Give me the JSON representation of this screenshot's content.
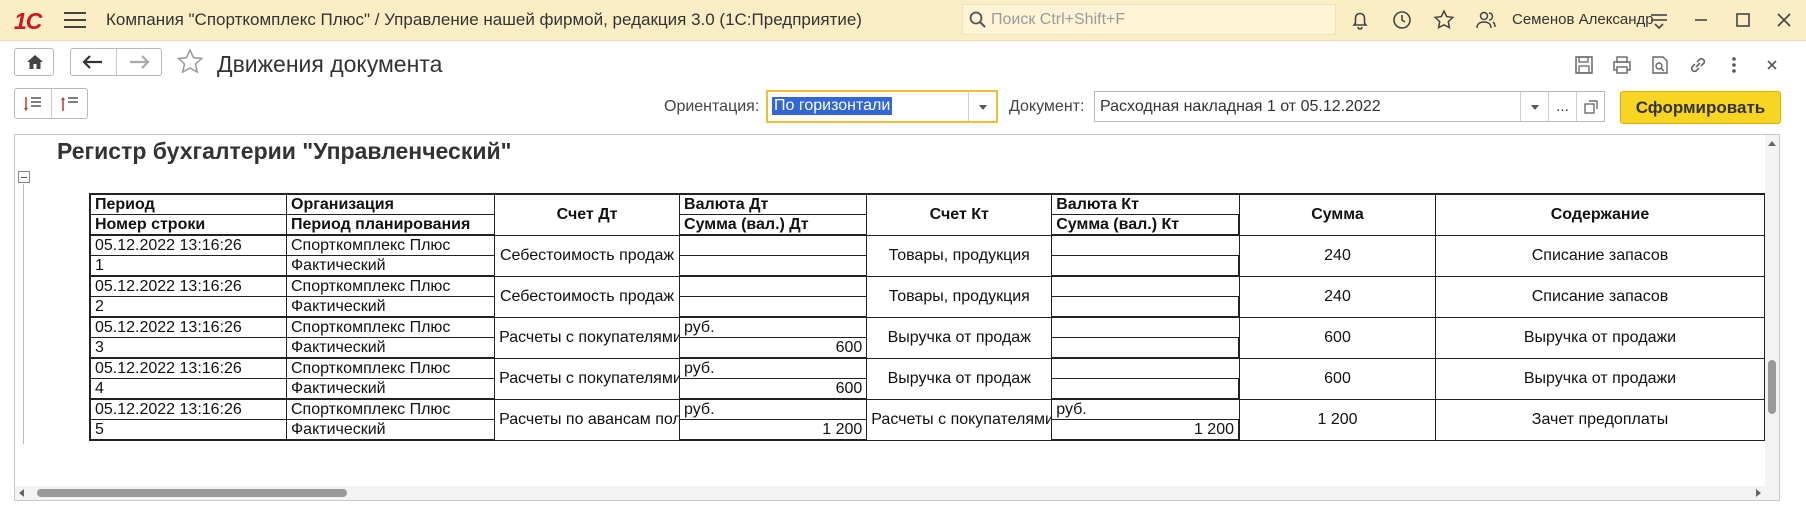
{
  "window": {
    "logo": "1С",
    "app_title": "Компания \"Спорткомплекс Плюс\" / Управление нашей фирмой, редакция 3.0  (1С:Предприятие)",
    "search_placeholder": "Поиск Ctrl+Shift+F",
    "user_name": "Семенов Александр"
  },
  "toolbar": {
    "doc_title": "Движения документа"
  },
  "form": {
    "orientation_label": "Ориентация:",
    "orientation_value": "По горизонтали",
    "document_label": "Документ:",
    "document_value": "Расходная накладная 1 от 05.12.2022",
    "ellipsis": "...",
    "generate_button": "Сформировать"
  },
  "report": {
    "title": "Регистр бухгалтерии \"Управленческий\"",
    "headers": {
      "period": "Период",
      "line_no": "Номер строки",
      "organization": "Организация",
      "plan_period": "Период планирования",
      "account_dt": "Счет Дт",
      "currency_dt": "Валюта Дт",
      "amount_cur_dt": "Сумма (вал.) Дт",
      "account_kt": "Счет Кт",
      "currency_kt": "Валюта Кт",
      "amount_cur_kt": "Сумма (вал.) Кт",
      "amount": "Сумма",
      "content": "Содержание"
    },
    "rows": [
      {
        "period": "05.12.2022 13:16:26",
        "line_no": "1",
        "organization": "Спорткомплекс Плюс",
        "plan_period": "Фактический",
        "account_dt": "Себестоимость продаж",
        "currency_dt": "",
        "amount_cur_dt": "",
        "account_kt": "Товары, продукция",
        "currency_kt": "",
        "amount_cur_kt": "",
        "amount": "240",
        "content": "Списание запасов"
      },
      {
        "period": "05.12.2022 13:16:26",
        "line_no": "2",
        "organization": "Спорткомплекс Плюс",
        "plan_period": "Фактический",
        "account_dt": "Себестоимость продаж",
        "currency_dt": "",
        "amount_cur_dt": "",
        "account_kt": "Товары, продукция",
        "currency_kt": "",
        "amount_cur_kt": "",
        "amount": "240",
        "content": "Списание запасов"
      },
      {
        "period": "05.12.2022 13:16:26",
        "line_no": "3",
        "organization": "Спорткомплекс Плюс",
        "plan_period": "Фактический",
        "account_dt": "Расчеты с покупателями",
        "currency_dt": "руб.",
        "amount_cur_dt": "600",
        "account_kt": "Выручка от продаж",
        "currency_kt": "",
        "amount_cur_kt": "",
        "amount": "600",
        "content": "Выручка от продажи"
      },
      {
        "period": "05.12.2022 13:16:26",
        "line_no": "4",
        "organization": "Спорткомплекс Плюс",
        "plan_period": "Фактический",
        "account_dt": "Расчеты с покупателями",
        "currency_dt": "руб.",
        "amount_cur_dt": "600",
        "account_kt": "Выручка от продаж",
        "currency_kt": "",
        "amount_cur_kt": "",
        "amount": "600",
        "content": "Выручка от продажи"
      },
      {
        "period": "05.12.2022 13:16:26",
        "line_no": "5",
        "organization": "Спорткомплекс Плюс",
        "plan_period": "Фактический",
        "account_dt": "Расчеты по авансам полученным",
        "currency_dt": "руб.",
        "amount_cur_dt": "1 200",
        "account_kt": "Расчеты с покупателями",
        "currency_kt": "руб.",
        "amount_cur_kt": "1 200",
        "amount": "1 200",
        "content": "Зачет предоплаты"
      }
    ]
  },
  "colors": {
    "title_bar": "#fbeec4",
    "logo": "#d2141e",
    "accent_button": "#f8d523",
    "focus_border": "#f0bd3b",
    "selection": "#3367d6"
  },
  "icons": [
    "menu-icon",
    "search-icon",
    "bell-icon",
    "history-icon",
    "star-icon",
    "users-icon",
    "settings-icon",
    "minimize-icon",
    "maximize-icon",
    "close-icon",
    "home-icon",
    "back-icon",
    "forward-icon",
    "favorite-star-icon",
    "save-icon",
    "print-icon",
    "preview-icon",
    "link-icon",
    "more-icon",
    "expand-groups-icon",
    "collapse-groups-icon",
    "open-icon"
  ]
}
